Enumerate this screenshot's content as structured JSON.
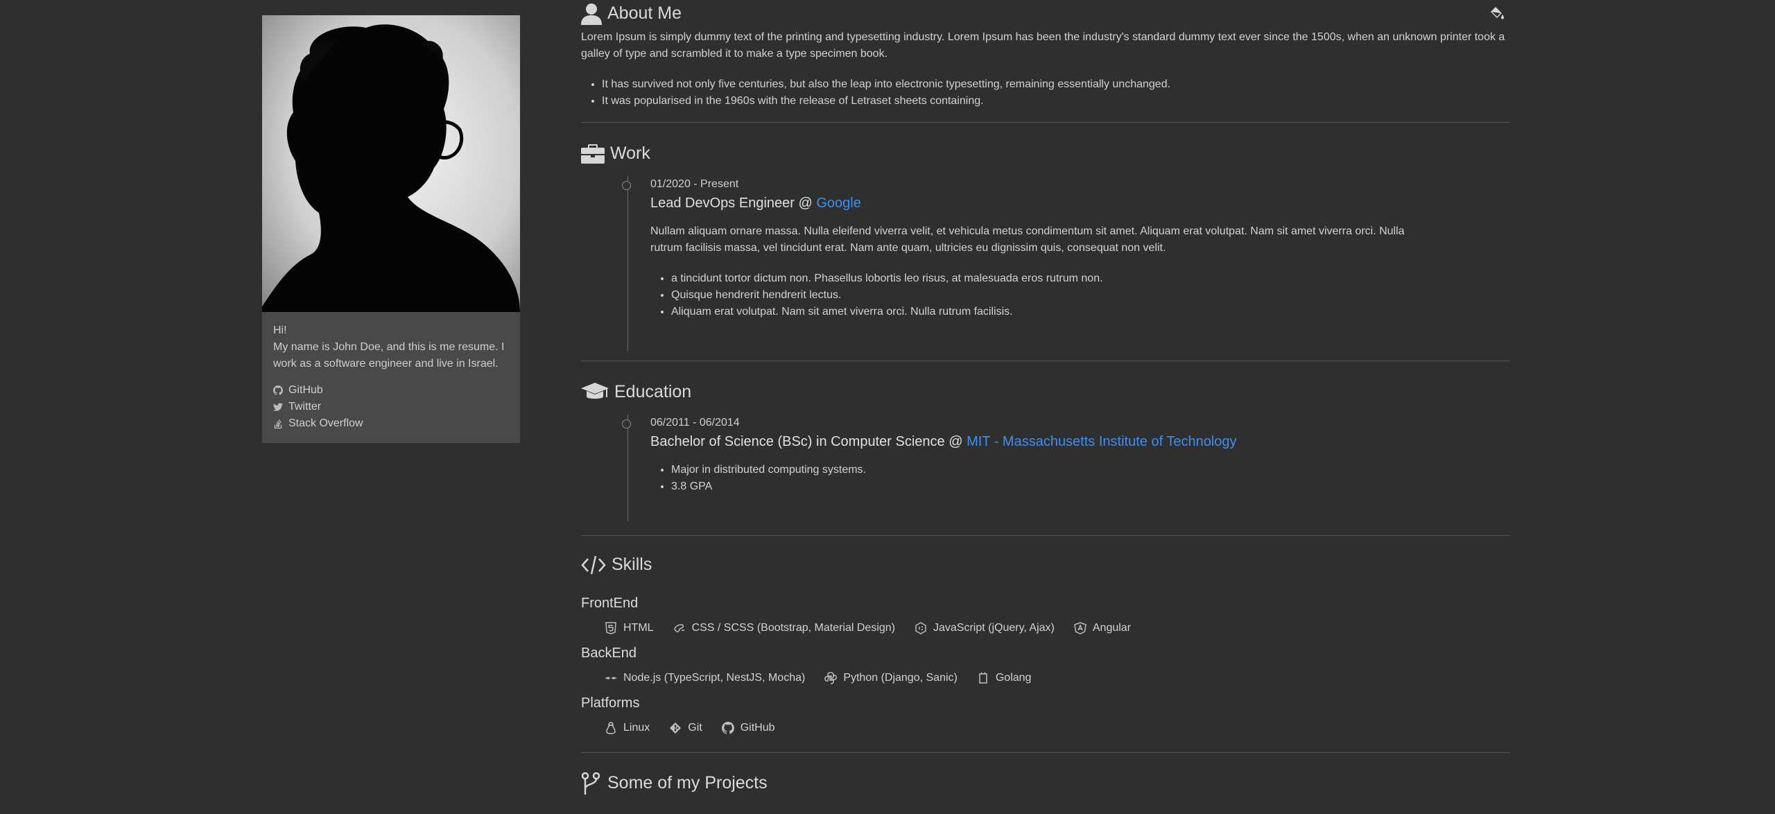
{
  "sidebar": {
    "greeting": "Hi!",
    "intro": "My name is John Doe, and this is me resume. I work as a software engineer and live in Israel.",
    "links": [
      "GitHub",
      "Twitter",
      "Stack Overflow"
    ]
  },
  "about": {
    "title": "About Me",
    "text": "Lorem Ipsum is simply dummy text of the printing and typesetting industry. Lorem Ipsum has been the industry's standard dummy text ever since the 1500s, when an unknown printer took a galley of type and scrambled it to make a type specimen book.",
    "bullets": [
      "It has survived not only five centuries, but also the leap into electronic typesetting, remaining essentially unchanged.",
      "It was popularised in the 1960s with the release of Letraset sheets containing."
    ]
  },
  "work": {
    "title": "Work",
    "entries": [
      {
        "date": "01/2020 - Present",
        "role": "Lead DevOps Engineer @ ",
        "org": "Google",
        "description": "Nullam aliquam ornare massa. Nulla eleifend viverra velit, et vehicula metus condimentum sit amet. Aliquam erat volutpat. Nam sit amet viverra orci. Nulla rutrum facilisis massa, vel tincidunt erat. Nam ante quam, ultricies eu dignissim quis, consequat non velit.",
        "bullets": [
          "a tincidunt tortor dictum non. Phasellus lobortis leo risus, at malesuada eros rutrum non.",
          "Quisque hendrerit hendrerit lectus.",
          "Aliquam erat volutpat. Nam sit amet viverra orci. Nulla rutrum facilisis."
        ]
      }
    ]
  },
  "education": {
    "title": "Education",
    "entries": [
      {
        "date": "06/2011 - 06/2014",
        "degree": "Bachelor of Science (BSc) in Computer Science @ ",
        "org": "MIT - Massachusetts Institute of Technology",
        "bullets": [
          "Major in distributed computing systems.",
          "3.8 GPA"
        ]
      }
    ]
  },
  "skills": {
    "title": "Skills",
    "groups": [
      {
        "name": "FrontEnd",
        "items": [
          "HTML",
          "CSS / SCSS (Bootstrap, Material Design)",
          "JavaScript (jQuery, Ajax)",
          "Angular"
        ]
      },
      {
        "name": "BackEnd",
        "items": [
          "Node.js (TypeScript, NestJS, Mocha)",
          "Python (Django, Sanic)",
          "Golang"
        ]
      },
      {
        "name": "Platforms",
        "items": [
          "Linux",
          "Git",
          "GitHub"
        ]
      }
    ]
  },
  "projects": {
    "title": "Some of my Projects"
  },
  "colors": {
    "background": "#2f2f2f",
    "card": "#494949",
    "link": "#3f8ef0",
    "divider": "#555555"
  }
}
